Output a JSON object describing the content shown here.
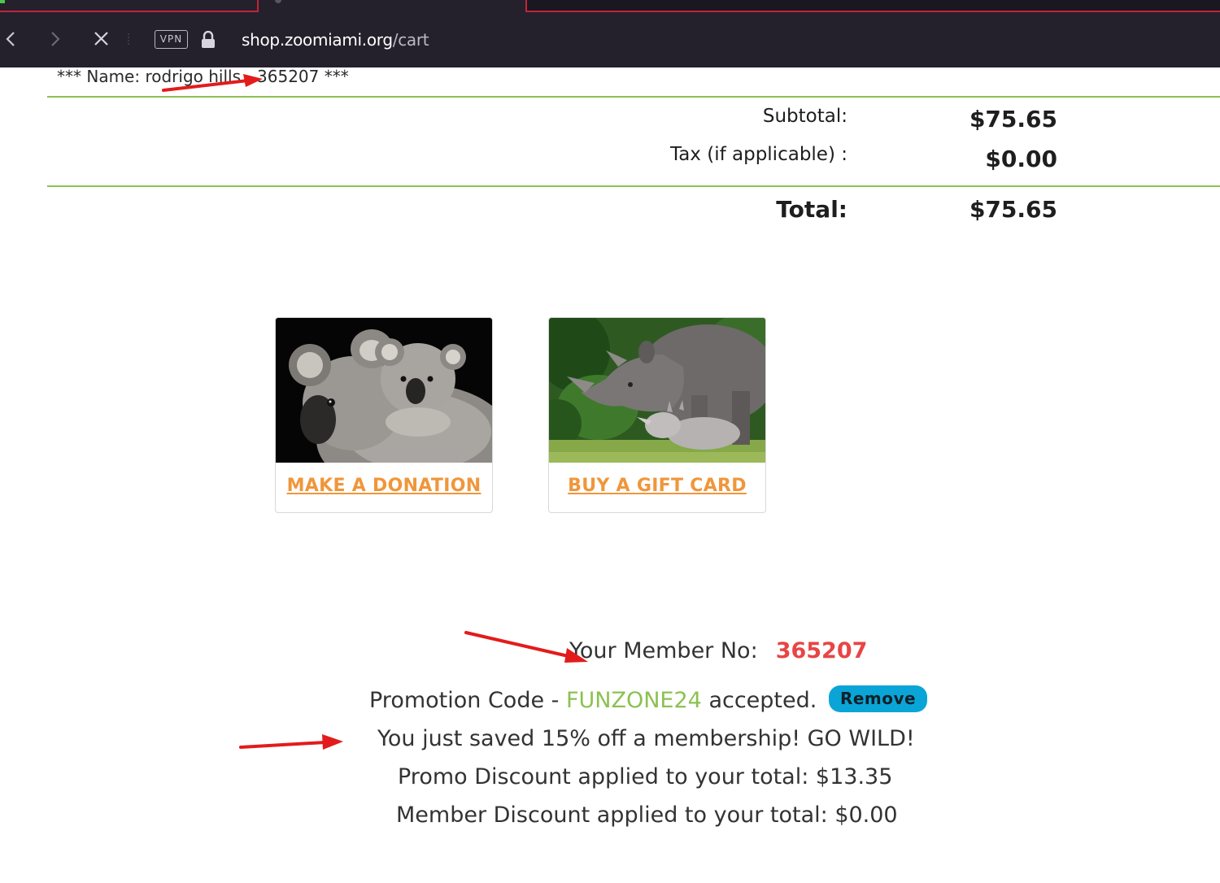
{
  "browser": {
    "vpn_label": "VPN",
    "url_host": "shop.zoomiami.org",
    "url_path": "/cart"
  },
  "cart": {
    "name_line": "*** Name: rodrigo hills",
    "name_number": "365207 ***",
    "subtotal_label": "Subtotal:",
    "subtotal_value": "$75.65",
    "tax_label": "Tax (if applicable) :",
    "tax_value": "$0.00",
    "total_label": "Total:",
    "total_value": "$75.65"
  },
  "cards": {
    "donation_label": "MAKE A DONATION",
    "gift_label": "BUY A GIFT CARD"
  },
  "member": {
    "label": "Your Member No:",
    "number": "365207"
  },
  "promo": {
    "prefix": "Promotion Code - ",
    "code": "FUNZONE24",
    "suffix": " accepted.",
    "remove_label": "Remove",
    "saved_text": "You just saved 15% off a membership! GO WILD!",
    "promo_discount_text": "Promo Discount applied to your total: $13.35",
    "member_discount_text": "Member Discount applied to your total: $0.00"
  },
  "colors": {
    "accent_green": "#8cc152",
    "link_orange": "#f0963a",
    "member_red": "#e84545",
    "remove_blue": "#0aa5d6",
    "annotation_red": "#e31b1b"
  }
}
